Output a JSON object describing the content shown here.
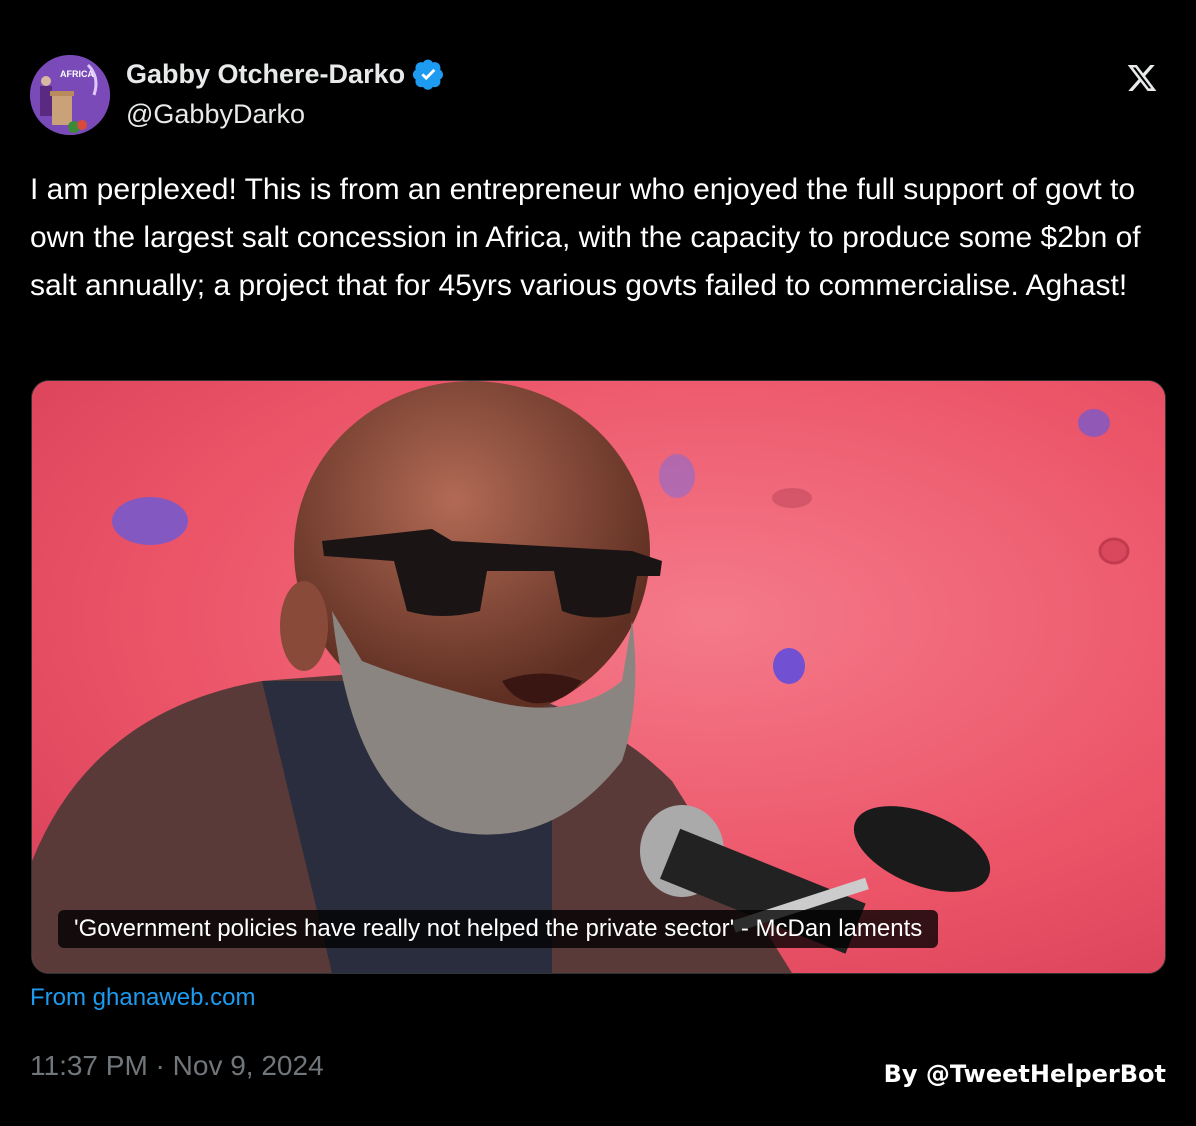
{
  "author": {
    "name": "Gabby Otchere-Darko",
    "handle": "@GabbyDarko",
    "verified": true,
    "avatar_icon": "avatar-speaker-podium",
    "avatar_text": "AFRICA"
  },
  "brand_icon": "x-logo-icon",
  "tweet": {
    "text": "I am perplexed! This is from an entrepreneur who enjoyed the full support of govt to own the largest salt concession in Africa, with the capacity to produce some $2bn of salt annually; a project that for 45yrs various govts failed to commercialise. Aghast!"
  },
  "link_card": {
    "caption": "'Government policies have really not helped the private sector' - McDan laments",
    "source": "From ghanaweb.com",
    "image_icon": "man-speaking-at-microphone-photo"
  },
  "timestamp": "11:37 PM · Nov 9, 2024",
  "watermark": "By @TweetHelperBot",
  "colors": {
    "background": "#000000",
    "text": "#e7e9ea",
    "muted": "#71767b",
    "link": "#1d9bf0",
    "verified": "#1d9bf0"
  }
}
